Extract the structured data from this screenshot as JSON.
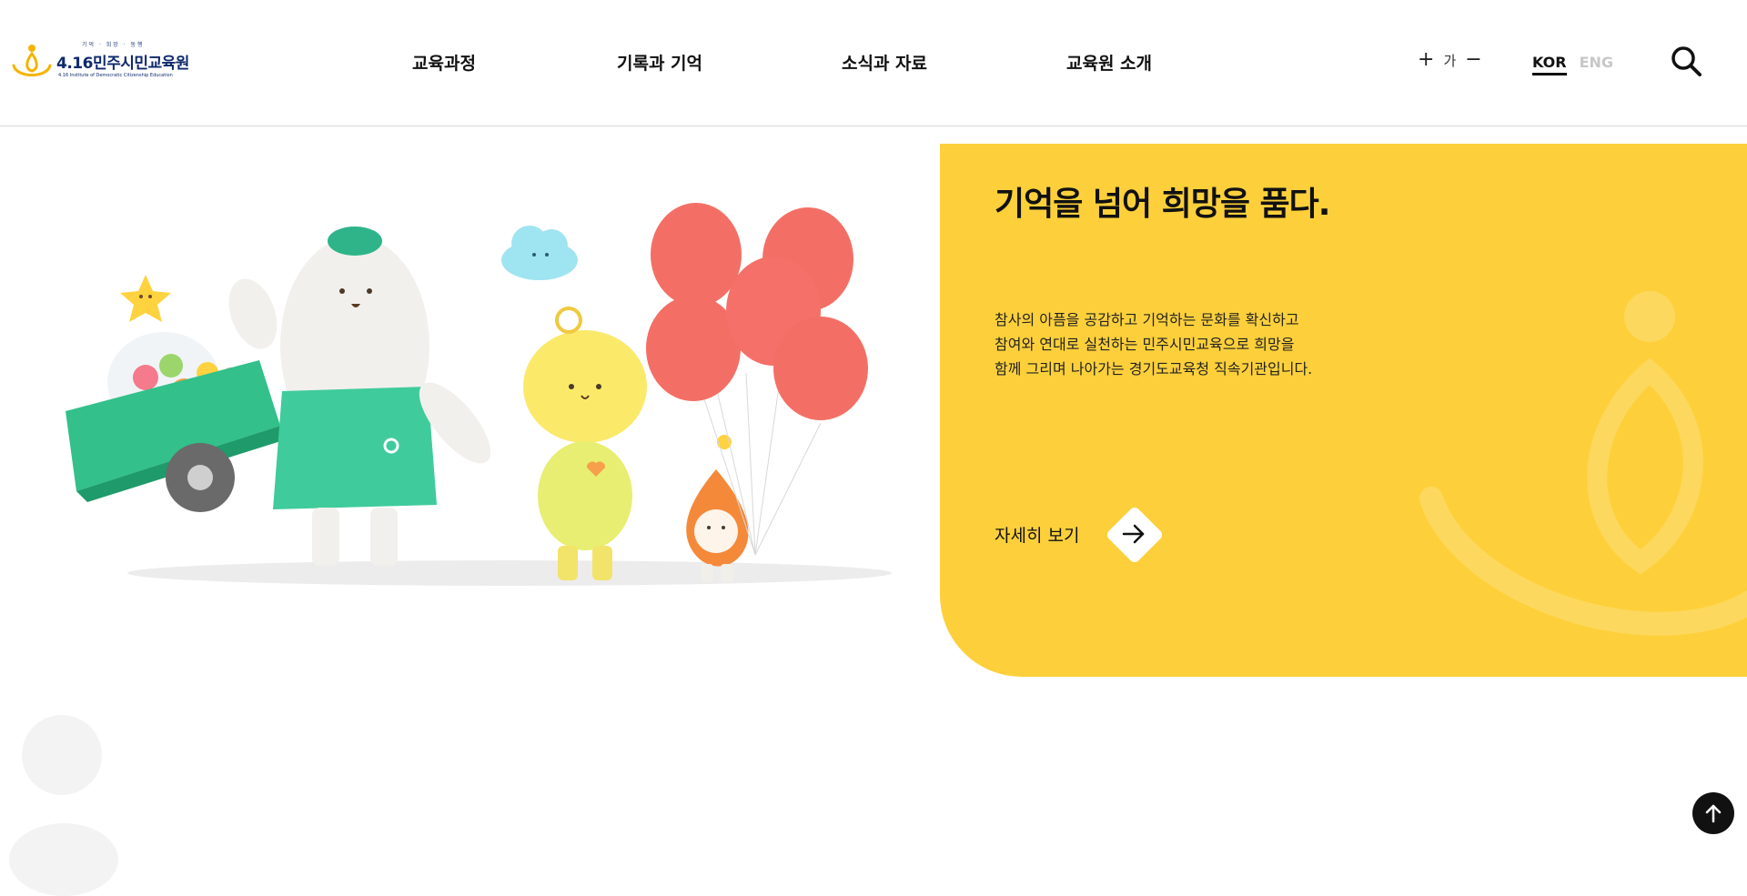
{
  "header": {
    "logo": {
      "tagline": "기억 · 희망 · 동행",
      "name": "4.16민주시민교육원",
      "sub": "4.16 Institute of Democratic Citizenship Education"
    },
    "nav": [
      {
        "label": "교육과정"
      },
      {
        "label": "기록과 기억"
      },
      {
        "label": "소식과 자료"
      },
      {
        "label": "교육원 소개"
      }
    ],
    "font_control": {
      "increase": "+",
      "label": "가",
      "decrease": "−"
    },
    "lang": {
      "kor": "KOR",
      "eng": "ENG"
    },
    "search_icon": "search-icon"
  },
  "hero": {
    "title": "기억을 넘어 희망을 품다.",
    "description": [
      "참사의 아픔을 공감하고 기억하는 문화를 확신하고",
      "참여와 연대로 실천하는 민주시민교육으로 희망을",
      "함께 그리며 나아가는 경기도교육청 직속기관입니다."
    ],
    "more_label": "자세히 보기",
    "more_icon": "arrow-right-icon",
    "accent_color": "#fdd03b"
  },
  "top_button_icon": "arrow-up-icon"
}
